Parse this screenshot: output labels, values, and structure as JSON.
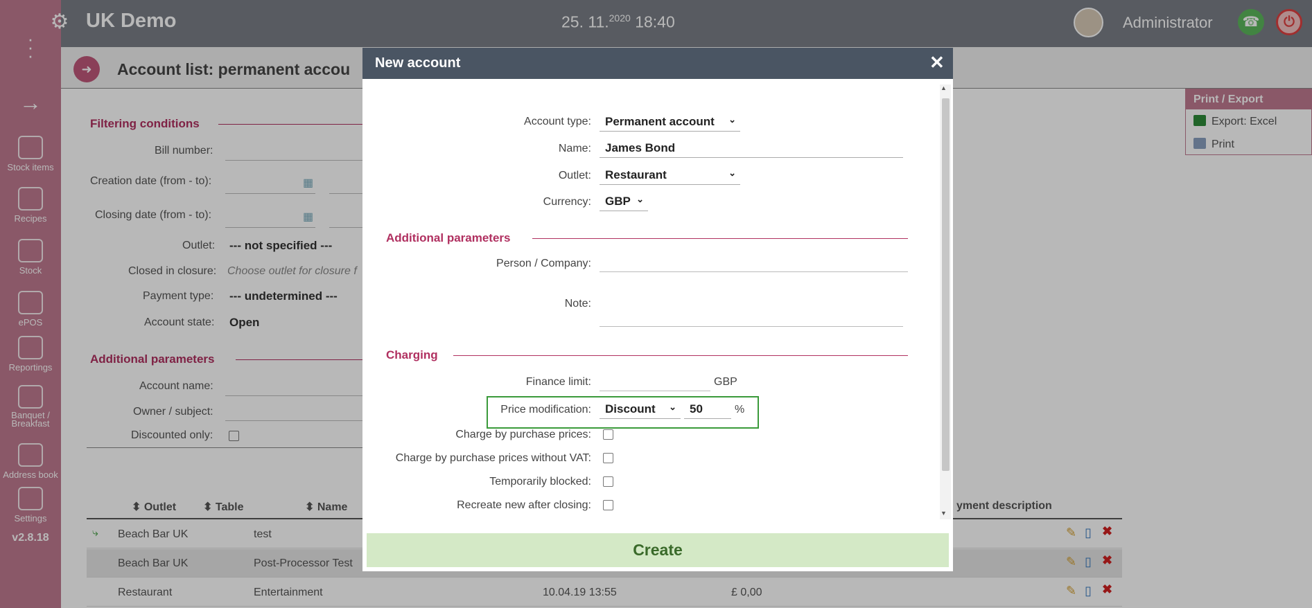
{
  "app": {
    "title": "UK Demo",
    "date": "25. 11.",
    "year": "2020",
    "time": "18:40",
    "user": "Administrator",
    "version": "v2.8.18"
  },
  "sidebar": {
    "items": [
      {
        "label": "Stock items"
      },
      {
        "label": "Recipes"
      },
      {
        "label": "Stock"
      },
      {
        "label": "ePOS"
      },
      {
        "label": "Reportings"
      },
      {
        "label": "Banquet /\nBreakfast"
      },
      {
        "label": "Address book"
      },
      {
        "label": "Settings"
      }
    ]
  },
  "page": {
    "title": "Account list: permanent accou"
  },
  "filter": {
    "title": "Filtering conditions",
    "bill_number": "Bill number:",
    "creation_date": "Creation date (from - to):",
    "closing_date": "Closing date (from - to):",
    "outlet_label": "Outlet:",
    "outlet_value": "--- not specified ---",
    "closed_in_closure": "Closed in closure:",
    "closed_placeholder": "Choose outlet for closure f",
    "payment_type": "Payment type:",
    "payment_value": "--- undetermined ---",
    "account_state": "Account state:",
    "state_value": "Open",
    "additional": "Additional parameters",
    "account_name": "Account name:",
    "owner": "Owner / subject:",
    "discounted": "Discounted only:"
  },
  "table": {
    "headers": [
      "Outlet",
      "Table",
      "Name",
      "yment description"
    ],
    "rows": [
      {
        "outlet": "Beach Bar UK",
        "name": "test",
        "date": "",
        "amount": ""
      },
      {
        "outlet": "Beach Bar UK",
        "name": "Post-Processor Test",
        "date": "",
        "amount": ""
      },
      {
        "outlet": "Restaurant",
        "name": "Entertainment",
        "date": "10.04.19 13:55",
        "amount": "£ 0,00"
      }
    ]
  },
  "print_export": {
    "title": "Print / Export",
    "excel": "Export: Excel",
    "print": "Print"
  },
  "modal": {
    "title": "New account",
    "account_type_label": "Account type:",
    "account_type": "Permanent account",
    "name_label": "Name:",
    "name": "James Bond",
    "outlet_label": "Outlet:",
    "outlet": "Restaurant",
    "currency_label": "Currency:",
    "currency": "GBP",
    "additional": "Additional parameters",
    "person_label": "Person / Company:",
    "note_label": "Note:",
    "charging": "Charging",
    "finance_label": "Finance limit:",
    "finance_unit": "GBP",
    "price_mod_label": "Price modification:",
    "price_mod": "Discount",
    "price_value": "50",
    "price_unit": "%",
    "charge_purchase": "Charge by purchase prices:",
    "charge_purchase_novat": "Charge by purchase prices without VAT:",
    "temp_blocked": "Temporarily blocked:",
    "recreate": "Recreate new after closing:",
    "create": "Create"
  }
}
